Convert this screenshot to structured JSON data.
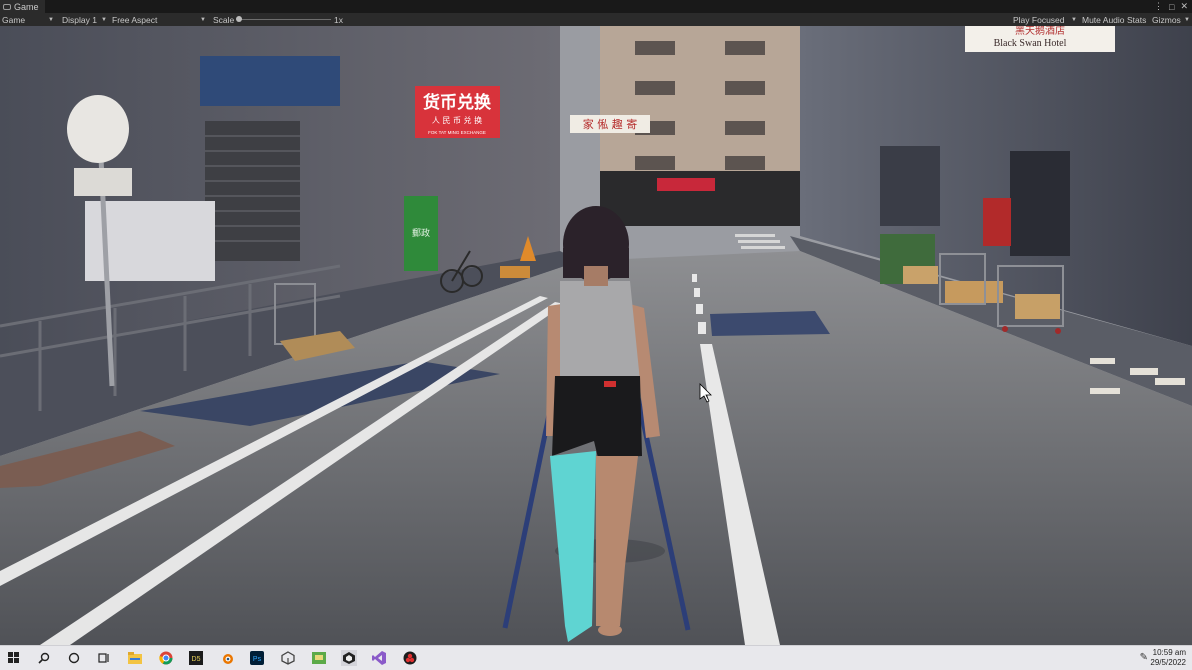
{
  "window": {
    "tab_label": "Game",
    "controls": [
      "⋮",
      "□",
      "✕"
    ]
  },
  "toolbar": {
    "game_mode": "Game",
    "display": "Display 1",
    "aspect": "Free Aspect",
    "scale_label": "Scale",
    "scale_value": "1x",
    "play_mode": "Play Focused",
    "mute_audio": "Mute Audio",
    "stats": "Stats",
    "gizmos": "Gizmos"
  },
  "scene": {
    "sign_currency_main": "货币兑换",
    "sign_currency_sub": "人 民 币 兑 换",
    "sign_currency_small": "FOK TAT MING EXCHANGE",
    "sign_middle": "家 俬 趣 寄",
    "hotel_chinese": "黑天鹅酒店",
    "hotel_english": "Black Swan Hotel",
    "mailbox_text": "郵政"
  },
  "taskbar": {
    "time": "10:59 am",
    "date": "29/5/2022",
    "apps": [
      "windows-start",
      "search",
      "cortana",
      "task-view",
      "file-explorer",
      "chrome",
      "davinci",
      "blender",
      "photoshop",
      "unity",
      "maps",
      "unity-hub",
      "visual-studio",
      "davinci-resolve"
    ]
  },
  "colors": {
    "editor_bg": "#2b2b2b",
    "sign_red": "#d8333b",
    "crutch_blue": "#2c3e78",
    "cast_teal": "#5fd4d2",
    "road_gray": "#5f6166",
    "taskbar_bg": "#e8e8ec"
  }
}
